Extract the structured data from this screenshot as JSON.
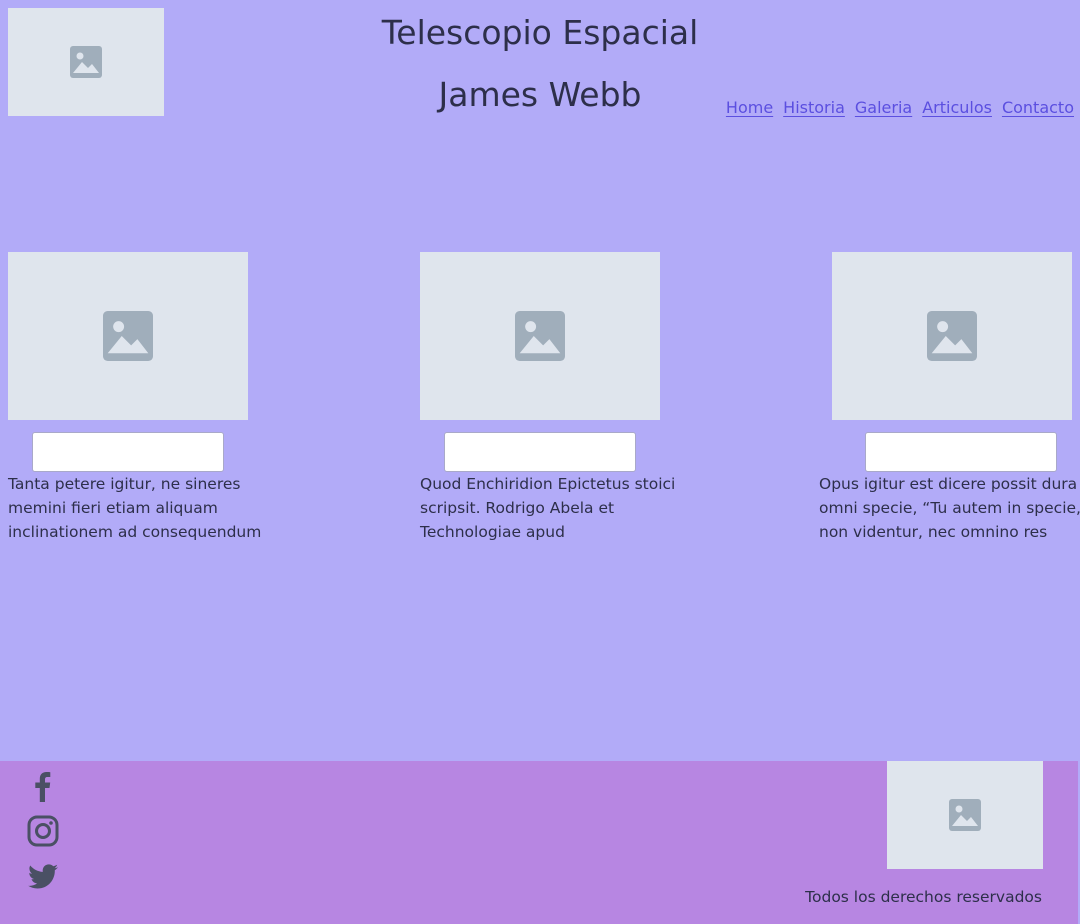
{
  "header": {
    "logo_icon": "image-placeholder-icon",
    "title_line1": "Telescopio Espacial",
    "title_line2": "James Webb"
  },
  "nav": {
    "items": [
      {
        "label": "Home"
      },
      {
        "label": "Historia"
      },
      {
        "label": "Galeria"
      },
      {
        "label": "Articulos"
      },
      {
        "label": "Contacto"
      }
    ]
  },
  "cards": [
    {
      "image_icon": "image-placeholder-icon",
      "button_label": "",
      "text": "Tanta petere igitur, ne sineres memini fieri etiam aliquam inclinationem ad consequendum"
    },
    {
      "image_icon": "image-placeholder-icon",
      "button_label": "",
      "text": "Quod Enchiridion Epictetus stoici scripsit. Rodrigo Abela et Technologiae apud"
    },
    {
      "image_icon": "image-placeholder-icon",
      "button_label": "",
      "text": "Opus igitur est dicere possit dura omni specie, “Tu autem in specie, non videntur, nec omnino res"
    }
  ],
  "footer": {
    "social": [
      "facebook-icon",
      "instagram-icon",
      "twitter-icon"
    ],
    "logo_icon": "image-placeholder-icon",
    "copyright": "Todos los derechos reservados"
  },
  "colors": {
    "background": "#b2abf8",
    "footer_background": "#b786e2",
    "placeholder": "#dfe5ed",
    "placeholder_icon": "#a0aebb",
    "link": "#5b4fe0",
    "text": "#2d2f4a",
    "social_icon": "#4a5064"
  }
}
